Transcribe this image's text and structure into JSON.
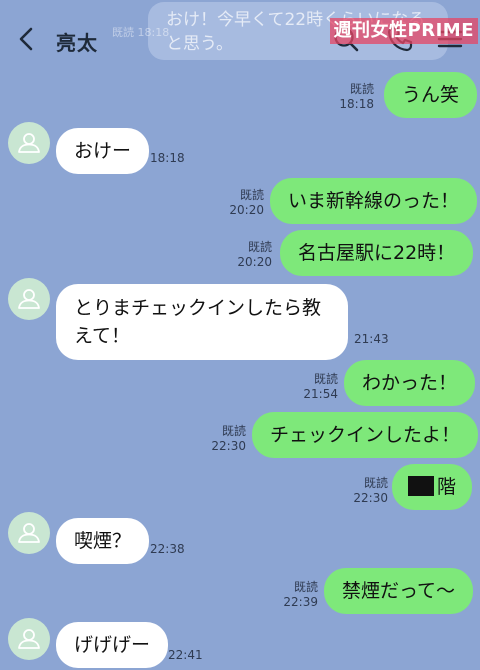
{
  "header": {
    "title": "亮太",
    "watermark": "週刊女性PRIME",
    "ghost_text": "おけ！今早くて22時くらいになると思う。",
    "ghost_meta": "既読 18:18"
  },
  "messages": [
    {
      "from": "me",
      "text": "うん笑",
      "read": "既読",
      "time": "18:18"
    },
    {
      "from": "them",
      "text": "おけー",
      "time": "18:18"
    },
    {
      "from": "me",
      "text": "いま新幹線のった！",
      "read": "既読",
      "time": "20:20"
    },
    {
      "from": "me",
      "text": "名古屋駅に22時！",
      "read": "既読",
      "time": "20:20"
    },
    {
      "from": "them",
      "text": "とりまチェックインしたら教えて！",
      "time": "21:43"
    },
    {
      "from": "me",
      "text": "わかった！",
      "read": "既読",
      "time": "21:54"
    },
    {
      "from": "me",
      "text": "チェックインしたよ！",
      "read": "既読",
      "time": "22:30"
    },
    {
      "from": "me",
      "text": "階",
      "read": "既読",
      "time": "22:30",
      "redacted": true
    },
    {
      "from": "them",
      "text": "喫煙？",
      "time": "22:38"
    },
    {
      "from": "me",
      "text": "禁煙だって〜",
      "read": "既読",
      "time": "22:39"
    },
    {
      "from": "them",
      "text": "げげげー",
      "time": "22:41"
    }
  ],
  "colors": {
    "background": "#8ca5d3",
    "my_bubble": "#7ee87a",
    "their_bubble": "#ffffff",
    "avatar": "#c9e6d2"
  },
  "icons": [
    "back-chevron-icon",
    "search-icon",
    "phone-icon",
    "menu-icon",
    "default-avatar-icon"
  ]
}
